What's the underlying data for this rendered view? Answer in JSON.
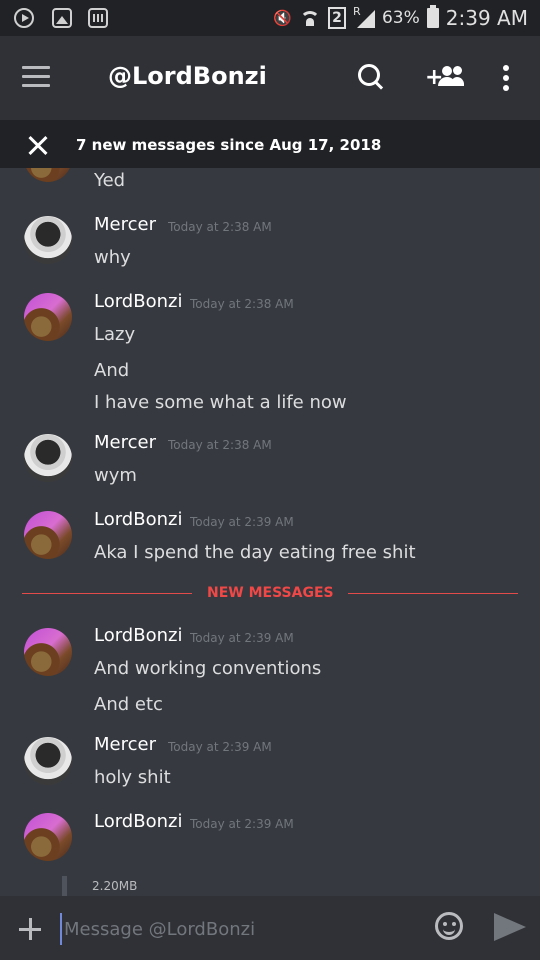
{
  "status_bar": {
    "sim_slot": "2",
    "signal_label": "R",
    "battery": "63%",
    "time": "2:39 AM"
  },
  "app_bar": {
    "title": "@LordBonzi"
  },
  "new_messages_bar": {
    "text": "7 new messages since Aug 17, 2018"
  },
  "chat": {
    "partial_top_message": "Yed",
    "groups": [
      {
        "author": "Mercer",
        "time": "Today at 2:38 AM",
        "lines": [
          "why"
        ]
      },
      {
        "author": "LordBonzi",
        "time": "Today at 2:38 AM",
        "lines": [
          "Lazy",
          "And",
          "I have some what a life now"
        ]
      },
      {
        "author": "Mercer",
        "time": "Today at 2:38 AM",
        "lines": [
          "wym"
        ]
      },
      {
        "author": "LordBonzi",
        "time": "Today at 2:39 AM",
        "lines": [
          "Aka I spend the day eating free shit"
        ]
      },
      {
        "author": "LordBonzi",
        "time": "Today at 2:39 AM",
        "lines": [
          "And working conventions",
          "And etc"
        ]
      },
      {
        "author": "Mercer",
        "time": "Today at 2:39 AM",
        "lines": [
          "holy shit"
        ]
      },
      {
        "author": "LordBonzi",
        "time": "Today at 2:39 AM",
        "lines": []
      }
    ],
    "new_messages_divider": "NEW MESSAGES",
    "attachment_size": "2.20MB"
  },
  "composer": {
    "placeholder": "Message @LordBonzi"
  },
  "colors": {
    "background": "#36393f",
    "header": "#2f3136",
    "status_bar": "#202225",
    "divider_red": "#f04747",
    "accent": "#7289da"
  }
}
